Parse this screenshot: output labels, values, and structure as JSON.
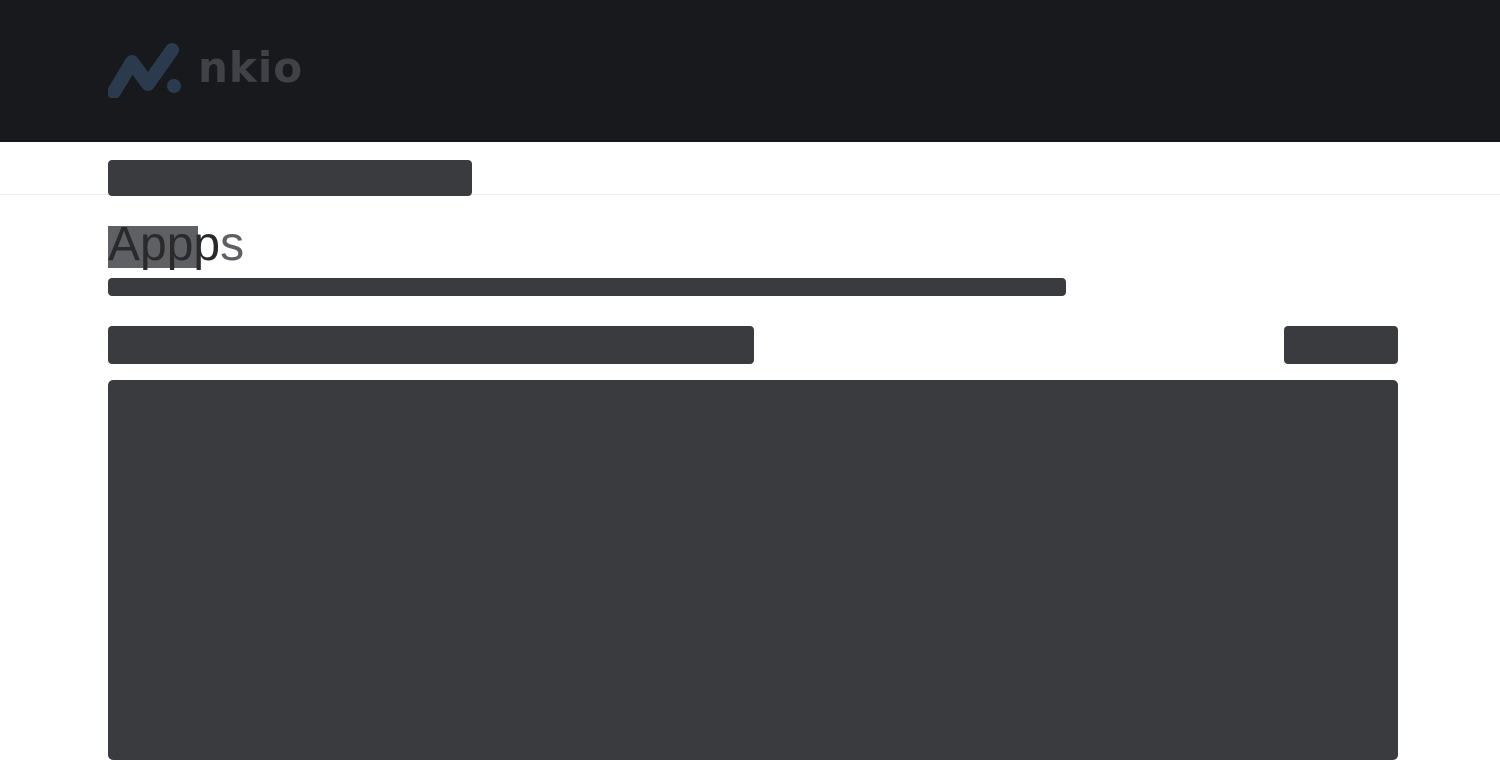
{
  "header": {
    "logo_text": "nkio",
    "logo_icon": "brand-wave-logo",
    "background": "#18191c",
    "logo_text_color": "#404247",
    "logo_mark_color": "#2b3a4c"
  },
  "page": {
    "title_part_highlighted": "App",
    "title_part_dark": "p",
    "title_part_rest": "s"
  },
  "placeholder_color": "#3a3b3f"
}
